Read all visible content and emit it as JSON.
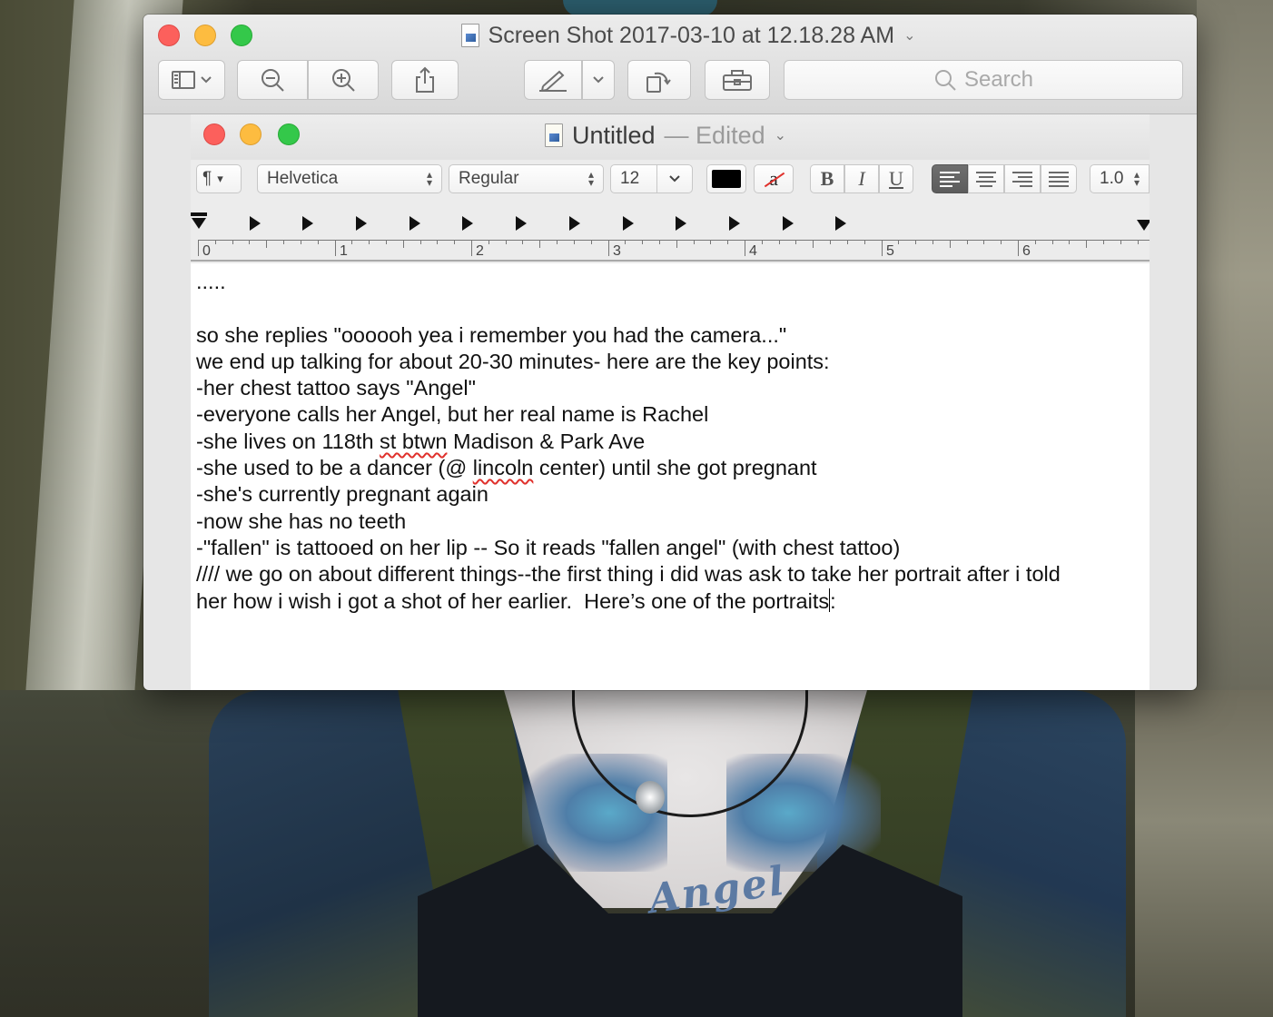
{
  "preview_window": {
    "title": "Screen Shot 2017-03-10 at 12.18.28 AM",
    "search_placeholder": "Search"
  },
  "textedit": {
    "title": "Untitled",
    "edited": "— Edited",
    "paragraph_style": "¶",
    "font_family": "Helvetica",
    "typeface": "Regular",
    "font_size": "12",
    "text_color": "#000000",
    "highlight_glyph": "a",
    "bold_label": "B",
    "italic_label": "I",
    "underline_label": "U",
    "line_spacing": "1.0",
    "ruler_numbers": [
      "0",
      "1",
      "2",
      "3",
      "4",
      "5",
      "6"
    ]
  },
  "document": {
    "lines": [
      ".....",
      "",
      "so she replies \"oooooh yea i remember you had the camera...\"",
      "we end up talking for about 20-30 minutes- here are the key points:",
      "-her chest tattoo says \"Angel\"",
      "-everyone calls her Angel, but her real name is Rachel",
      "-she lives on 118th ",
      "st btwn",
      " Madison & Park Ave",
      "-she used to be a dancer (@ ",
      "lincoln",
      " center) until she got pregnant",
      "-she's currently pregnant again",
      "-now she has no teeth",
      "-\"fallen\" is tattooed on her lip -- So it reads \"fallen angel\" (with chest tattoo)",
      "//// we go on about different things--the first thing i did was ask to take her portrait after i told",
      "her how i wish i got a shot of her earlier.  Here’s one of the portraits",
      ":"
    ]
  },
  "background": {
    "tattoo_text": "Angel"
  },
  "colors": {
    "close": "#fc605c",
    "minimize": "#fdbc40",
    "zoom": "#34c84a",
    "spellcheck": "#e0312c"
  }
}
